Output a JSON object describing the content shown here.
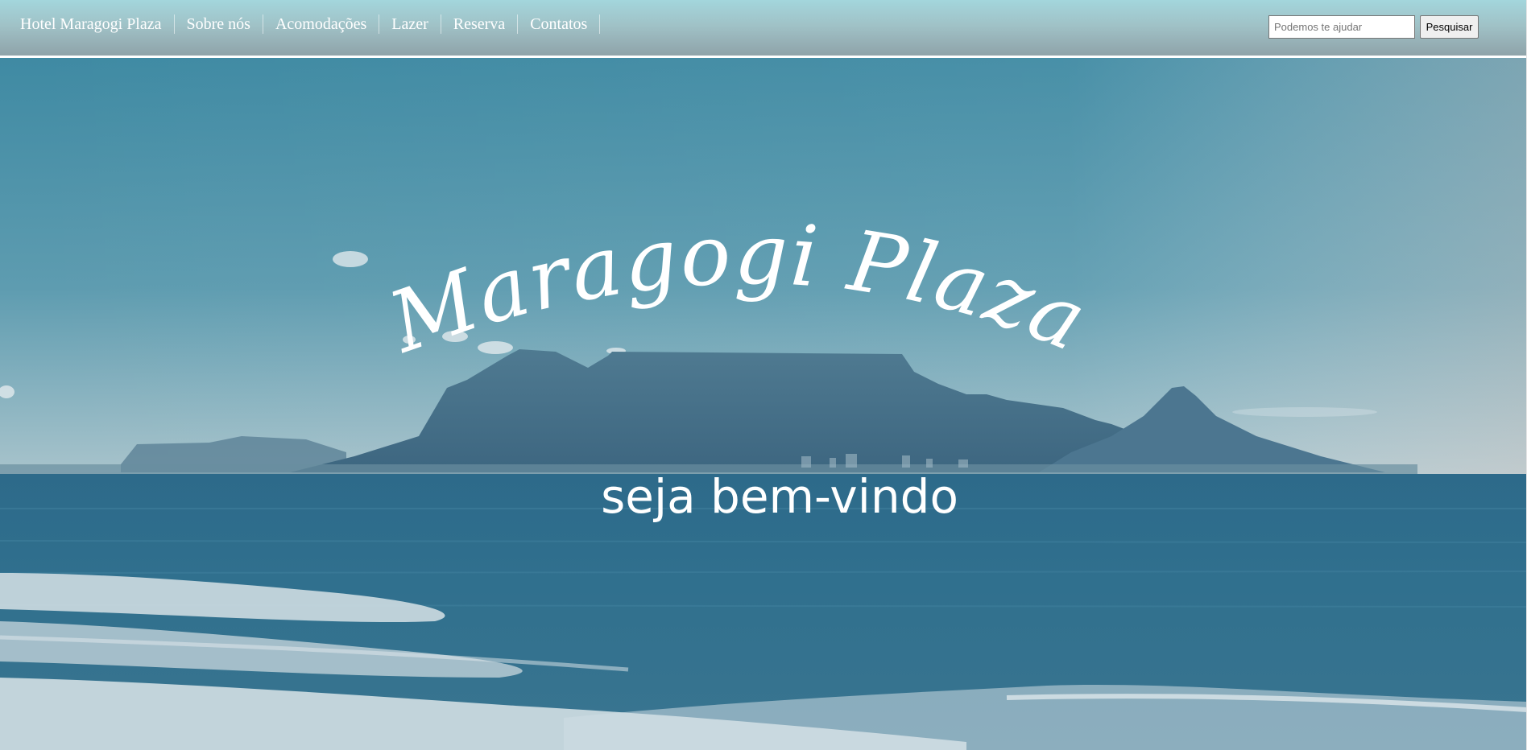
{
  "nav": {
    "items": [
      {
        "label": "Hotel Maragogi Plaza"
      },
      {
        "label": "Sobre nós"
      },
      {
        "label": "Acomodações"
      },
      {
        "label": "Lazer"
      },
      {
        "label": "Reserva"
      },
      {
        "label": "Contatos"
      }
    ],
    "search": {
      "placeholder": "Podemos te ajudar",
      "value": "",
      "button_label": "Pesquisar"
    }
  },
  "hero": {
    "title": "Maragogi Plaza",
    "subtitle": "seja bem-vindo"
  },
  "colors": {
    "nav_top": "#a3d6dc",
    "nav_bottom": "#8fa3a9",
    "sky": "#4b8ea4",
    "sea": "#2f6784",
    "mountain": "#456e86",
    "text": "#ffffff"
  }
}
